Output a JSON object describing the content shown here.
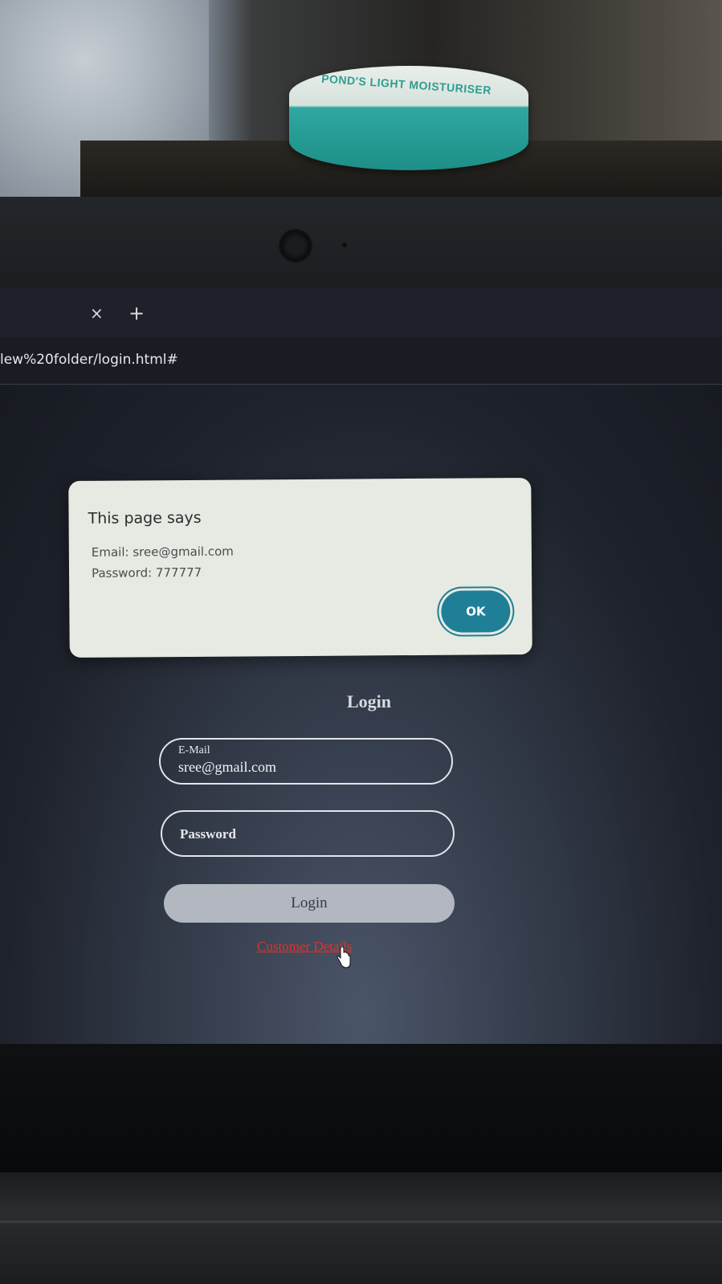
{
  "environment": {
    "jar_label": "POND'S LIGHT MOISTURISER"
  },
  "browser": {
    "tab_close_glyph": "×",
    "new_tab_glyph": "+",
    "url": "lew%20folder/login.html#"
  },
  "dialog": {
    "title": "This page says",
    "line1": "Email: sree@gmail.com",
    "line2": "Password: 777777",
    "ok_label": "OK"
  },
  "login_form": {
    "heading": "Login",
    "email_label": "E-Mail",
    "email_value": "sree@gmail.com",
    "password_placeholder": "Password",
    "submit_label": "Login",
    "customer_link": "Customer Details"
  },
  "colors": {
    "dialog_background": "#e6eae2",
    "ok_button": "#1f7f97",
    "login_button": "#b3b8c0",
    "link": "#e0322a"
  }
}
